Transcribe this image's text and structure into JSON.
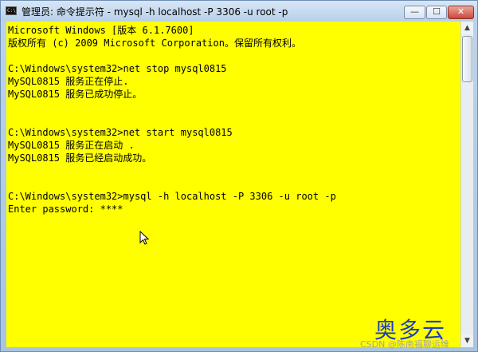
{
  "window": {
    "title": "管理员: 命令提示符 - mysql  -h localhost -P 3306 -u root -p",
    "title_icon_label": "C:\\",
    "buttons": {
      "minimize": "—",
      "maximize": "☐",
      "close": "✕"
    }
  },
  "console": {
    "background_color": "#ffff00",
    "text_color": "#000000",
    "lines": [
      "Microsoft Windows [版本 6.1.7600]",
      "版权所有 (c) 2009 Microsoft Corporation。保留所有权利。",
      "",
      "C:\\Windows\\system32>net stop mysql0815",
      "MySQL0815 服务正在停止.",
      "MySQL0815 服务已成功停止。",
      "",
      "",
      "C:\\Windows\\system32>net start mysql0815",
      "MySQL0815 服务正在启动 .",
      "MySQL0815 服务已经启动成功。",
      "",
      "",
      "C:\\Windows\\system32>mysql -h localhost -P 3306 -u root -p",
      "Enter password: ****"
    ]
  },
  "scrollbar": {
    "up": "▲",
    "down": "▼"
  },
  "watermark": {
    "logo": "奥多云",
    "csdn": "CSDN @陈南福聊运维"
  },
  "icons": {
    "title_icon": "cmd-icon",
    "cursor": "mouse-pointer-icon"
  }
}
